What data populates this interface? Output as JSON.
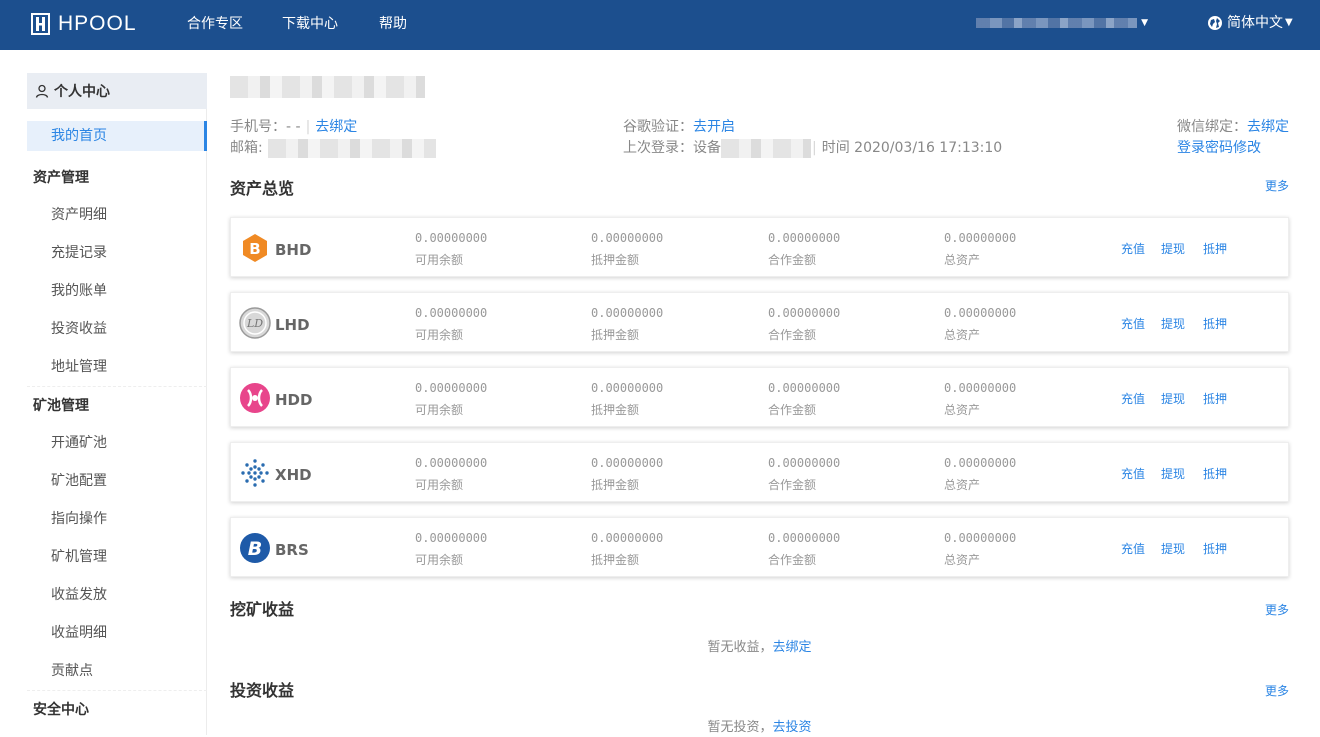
{
  "header": {
    "logo_text": "HPOOL",
    "nav": [
      "合作专区",
      "下载中心",
      "帮助"
    ],
    "language": "简体中文"
  },
  "sidebar": {
    "title": "个人中心",
    "active": "我的首页",
    "sections": [
      {
        "title": "资产管理",
        "items": [
          "资产明细",
          "充提记录",
          "我的账单",
          "投资收益",
          "地址管理"
        ]
      },
      {
        "title": "矿池管理",
        "items": [
          "开通矿池",
          "矿池配置",
          "指向操作",
          "矿机管理",
          "收益发放",
          "收益明细",
          "贡献点"
        ]
      },
      {
        "title": "安全中心",
        "items": []
      }
    ]
  },
  "profile": {
    "phone_label": "手机号：- -",
    "phone_bind": "去绑定",
    "email_label": "邮箱:",
    "google_label": "谷歌验证：",
    "google_action": "去开启",
    "last_login_label": "上次登录：设备",
    "last_login_time": "时间 2020/03/16 17:13:10",
    "wechat_label": "微信绑定：",
    "wechat_action": "去绑定",
    "password_change": "登录密码修改"
  },
  "assets": {
    "title": "资产总览",
    "more": "更多",
    "labels": [
      "可用余额",
      "抵押金额",
      "合作金额",
      "总资产"
    ],
    "actions": [
      "充值",
      "提现",
      "抵押"
    ],
    "coins": [
      {
        "name": "BHD",
        "icon": "bhd-coin-icon",
        "color": "#f08a24",
        "values": [
          "0.00000000",
          "0.00000000",
          "0.00000000",
          "0.00000000"
        ]
      },
      {
        "name": "LHD",
        "icon": "lhd-coin-icon",
        "color": "#9a9a9a",
        "values": [
          "0.00000000",
          "0.00000000",
          "0.00000000",
          "0.00000000"
        ]
      },
      {
        "name": "HDD",
        "icon": "hdd-coin-icon",
        "color": "#e8458b",
        "values": [
          "0.00000000",
          "0.00000000",
          "0.00000000",
          "0.00000000"
        ]
      },
      {
        "name": "XHD",
        "icon": "xhd-coin-icon",
        "color": "#2a6cb0",
        "values": [
          "0.00000000",
          "0.00000000",
          "0.00000000",
          "0.00000000"
        ]
      },
      {
        "name": "BRS",
        "icon": "brs-coin-icon",
        "color": "#1e5aa8",
        "values": [
          "0.00000000",
          "0.00000000",
          "0.00000000",
          "0.00000000"
        ]
      }
    ]
  },
  "mining": {
    "title": "挖矿收益",
    "more": "更多",
    "empty_text": "暂无收益，",
    "empty_link": "去绑定"
  },
  "investment": {
    "title": "投资收益",
    "more": "更多",
    "empty_text": "暂无投资，",
    "empty_link": "去投资"
  },
  "colors": {
    "header_bg": "#1c4f8e",
    "accent": "#2b85e4"
  }
}
